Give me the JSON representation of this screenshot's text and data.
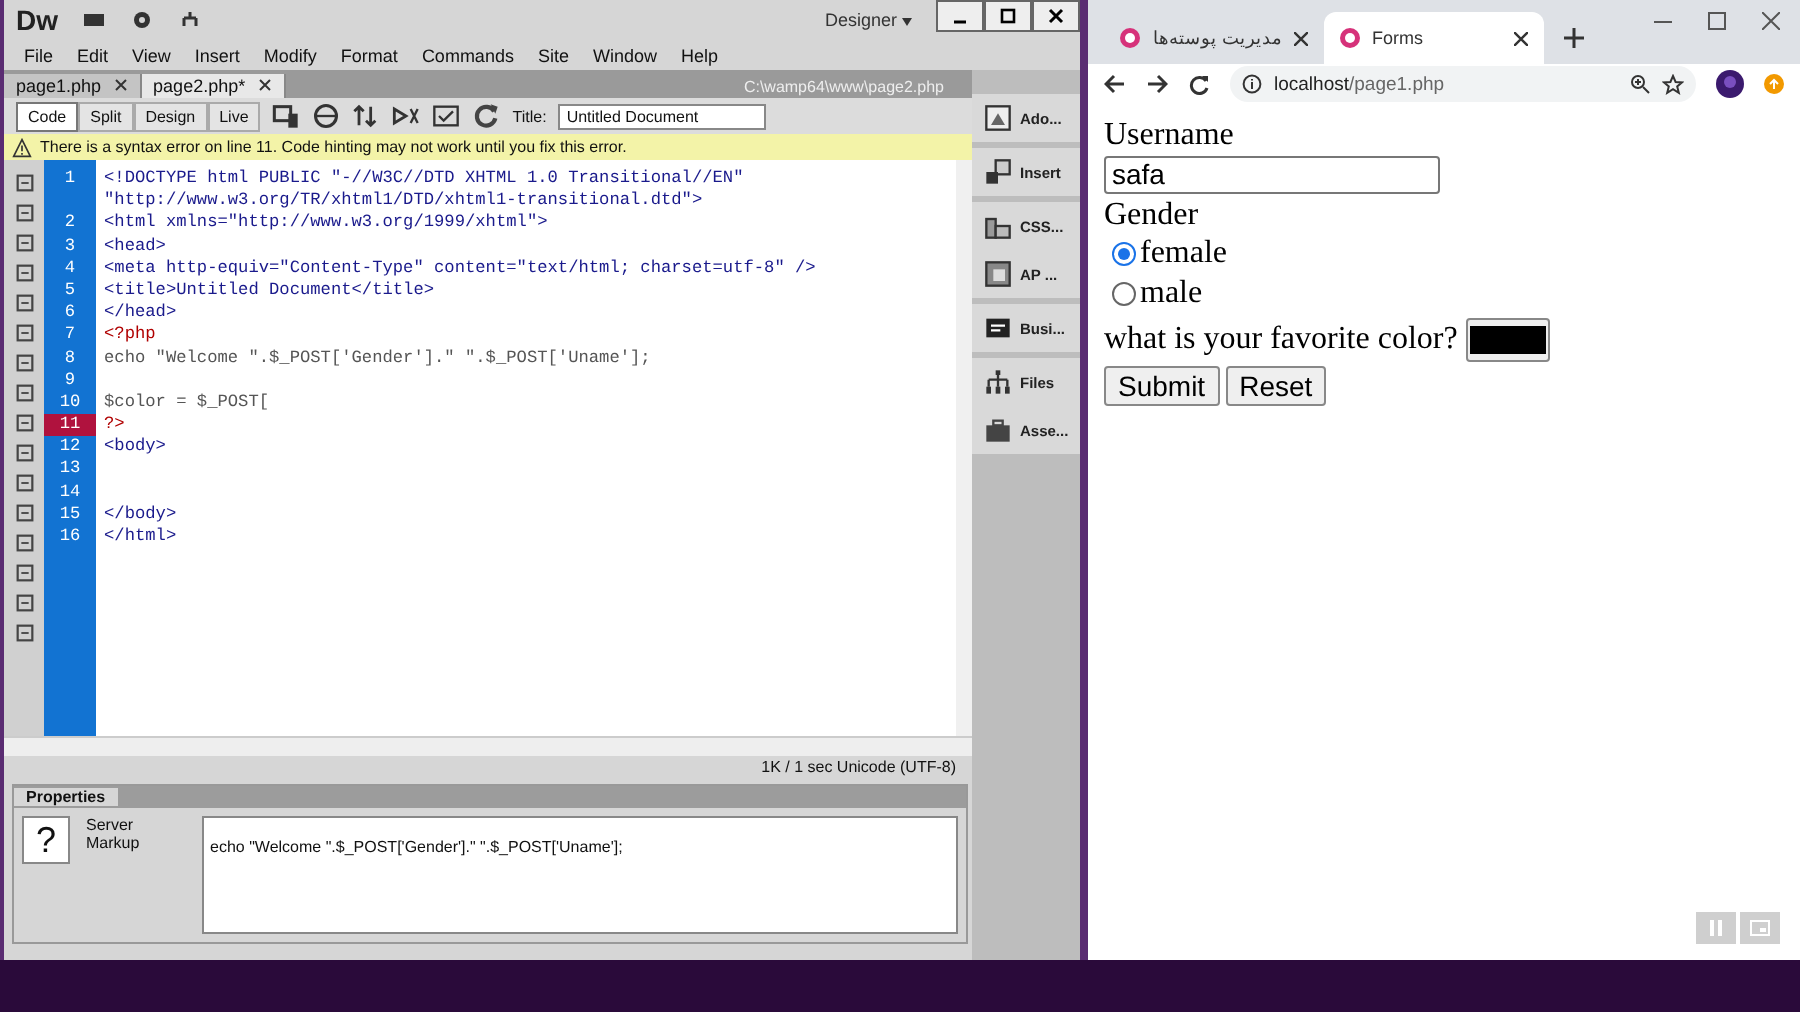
{
  "dreamweaver": {
    "logo": "Dw",
    "workspace": "Designer",
    "menu": [
      "File",
      "Edit",
      "View",
      "Insert",
      "Modify",
      "Format",
      "Commands",
      "Site",
      "Window",
      "Help"
    ],
    "documents": [
      {
        "label": "page1.php",
        "selected": false
      },
      {
        "label": "page2.php*",
        "selected": true
      }
    ],
    "file_path": "C:\\wamp64\\www\\page2.php",
    "view_buttons": [
      {
        "label": "Code",
        "selected": true
      },
      {
        "label": "Split",
        "selected": false
      },
      {
        "label": "Design",
        "selected": false
      },
      {
        "label": "Live",
        "selected": false
      }
    ],
    "title_label": "Title:",
    "title_value": "Untitled Document",
    "warning": "There is a syntax error on line 11.  Code hinting may not work until you fix this error.",
    "code_lines": [
      {
        "number": "1",
        "text": "<!DOCTYPE html PUBLIC \"-//W3C//DTD XHTML 1.0 Transitional//EN\"",
        "kind": "tag",
        "error": false
      },
      {
        "text": "\"http://www.w3.org/TR/xhtml1/DTD/xhtml1-transitional.dtd\">",
        "kind": "tag",
        "error": false
      },
      {
        "number": "2",
        "text": "<html xmlns=\"http://www.w3.org/1999/xhtml\">",
        "kind": "tag",
        "error": false
      },
      {
        "number": "3",
        "text": "<head>",
        "kind": "tag",
        "error": false
      },
      {
        "number": "4",
        "text": "<meta http-equiv=\"Content-Type\" content=\"text/html; charset=utf-8\" />",
        "kind": "tag",
        "error": false
      },
      {
        "number": "5",
        "text": "<title>Untitled Document</title>",
        "kind": "tag",
        "error": false
      },
      {
        "number": "6",
        "text": "</head>",
        "kind": "tag",
        "error": false
      },
      {
        "number": "7",
        "text": "<?php",
        "kind": "php",
        "error": false
      },
      {
        "number": "8",
        "text": "echo \"Welcome \".$_POST['Gender'].\" \".$_POST['Uname'];",
        "kind": "script",
        "error": false
      },
      {
        "number": "9",
        "error": false
      },
      {
        "number": "10",
        "text": "$color = $_POST[",
        "kind": "script",
        "error": false
      },
      {
        "number": "11",
        "text": "?>",
        "kind": "php",
        "error": true
      },
      {
        "number": "12",
        "text": "<body>",
        "kind": "tag",
        "error": false
      },
      {
        "number": "13",
        "error": false
      },
      {
        "number": "14",
        "error": false
      },
      {
        "number": "15",
        "text": "</body>",
        "kind": "tag",
        "error": false
      },
      {
        "number": "16",
        "text": "</html>",
        "kind": "tag",
        "error": false
      }
    ],
    "status": "1K / 1 sec  Unicode (UTF-8)",
    "panels": [
      {
        "label": "Ado...",
        "kind": "adobe"
      },
      {
        "label": "Insert",
        "kind": "insert"
      },
      {
        "label": "CSS...",
        "kind": "css"
      },
      {
        "label": "AP ...",
        "kind": "ap"
      },
      {
        "label": "Busi...",
        "kind": "business"
      },
      {
        "label": "Files",
        "kind": "files"
      },
      {
        "label": "Asse...",
        "kind": "assets"
      }
    ],
    "properties": {
      "title": "Properties",
      "help_glyph": "?",
      "label": "Server Markup",
      "code": "echo \"Welcome \".$_POST['Gender'].\" \".$_POST['Uname'];"
    }
  },
  "browser": {
    "tabs": [
      {
        "label": "مدیریت پوسته‌ها",
        "selected": false
      },
      {
        "label": "Forms",
        "selected": true
      }
    ],
    "url_host": "localhost",
    "url_path": "/page1.php",
    "form": {
      "username_label": "Username",
      "username_value": "safa",
      "gender_label": "Gender",
      "options": [
        {
          "label": "female",
          "selected": true
        },
        {
          "label": "male",
          "selected": false
        }
      ],
      "color_label": "what is your favorite color?",
      "buttons": [
        "Submit",
        "Reset"
      ]
    }
  }
}
